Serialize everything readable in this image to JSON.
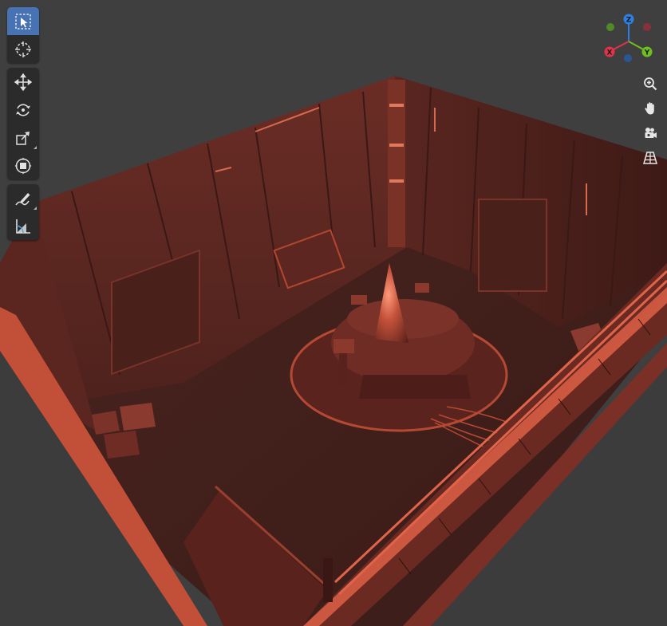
{
  "viewport": {
    "background": "#3f3f3f",
    "scene_tint": "#8a3a2e"
  },
  "toolbar": {
    "groups": [
      {
        "tools": [
          {
            "name": "select-box-tool",
            "icon": "select-box-icon",
            "active": true
          },
          {
            "name": "cursor-tool",
            "icon": "cursor-icon",
            "active": false
          }
        ]
      },
      {
        "tools": [
          {
            "name": "move-tool",
            "icon": "move-icon",
            "active": false
          },
          {
            "name": "rotate-tool",
            "icon": "rotate-icon",
            "active": false
          },
          {
            "name": "scale-tool",
            "icon": "scale-icon",
            "active": false
          },
          {
            "name": "transform-tool",
            "icon": "transform-icon",
            "active": false
          }
        ]
      },
      {
        "tools": [
          {
            "name": "annotate-tool",
            "icon": "annotate-pencil-icon",
            "active": false
          },
          {
            "name": "measure-tool",
            "icon": "measure-ruler-icon",
            "active": false
          }
        ]
      }
    ]
  },
  "gizmo": {
    "axes": [
      {
        "label": "Z",
        "color": "#2f7fe0"
      },
      {
        "label": "Y",
        "color": "#6fbf1f"
      },
      {
        "label": "X",
        "color": "#e0344a"
      }
    ],
    "negative_colors": [
      "#8a2f3c",
      "#4f8a26",
      "#2b5694"
    ]
  },
  "nav_buttons": [
    {
      "name": "zoom-button",
      "icon": "zoom-in-icon"
    },
    {
      "name": "pan-button",
      "icon": "hand-pan-icon"
    },
    {
      "name": "camera-view-button",
      "icon": "camera-icon"
    },
    {
      "name": "perspective-toggle-button",
      "icon": "grid-perspective-icon"
    }
  ]
}
